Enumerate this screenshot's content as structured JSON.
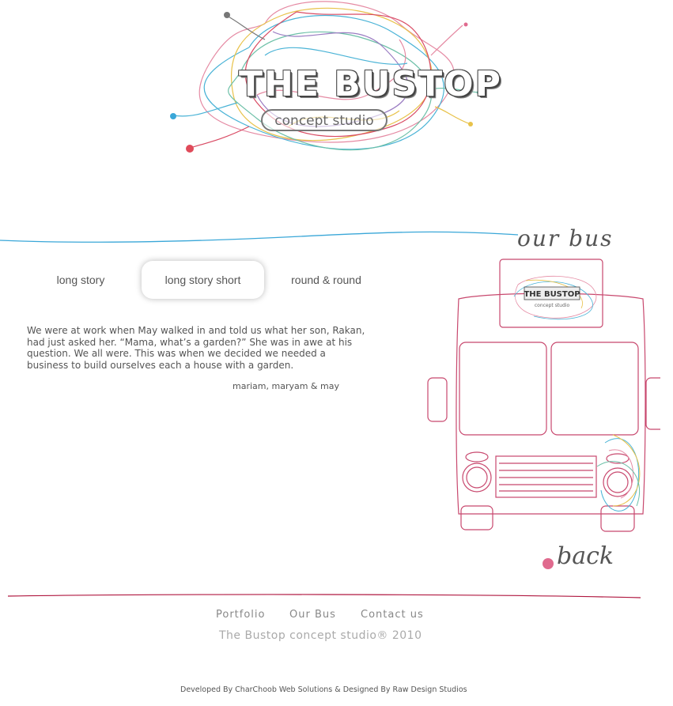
{
  "logo": {
    "title": "THE BUSTOP",
    "subtitle": "concept studio"
  },
  "our_bus": {
    "title": "our bus",
    "mini_logo_title": "THE BUSTOP",
    "mini_logo_subtitle": "concept studio"
  },
  "tabs": [
    {
      "label": "long story"
    },
    {
      "label": "long story short",
      "selected": true
    },
    {
      "label": "round & round"
    }
  ],
  "story": {
    "text": "We were at work when May walked in and told us what her son, Rakan, had just asked her. “Mama, what’s a garden?” She was in awe at his question. We all were. This was when we decided we needed a business to build ourselves each a house with a garden.",
    "signature": "mariam, maryam & may"
  },
  "back": {
    "label": "back"
  },
  "footer": {
    "links": [
      {
        "label": "Portfolio"
      },
      {
        "label": "Our Bus"
      },
      {
        "label": "Contact us"
      }
    ],
    "copyright": "The Bustop concept studio®  2010",
    "developer": "Developed By CharChoob Web Solutions & Designed By Raw Design Studios"
  },
  "colors": {
    "accent_pink": "#e06a8e",
    "wave_blue": "#3aa7d8",
    "bus_outline": "#c8486e",
    "footer_line": "#b01840"
  }
}
